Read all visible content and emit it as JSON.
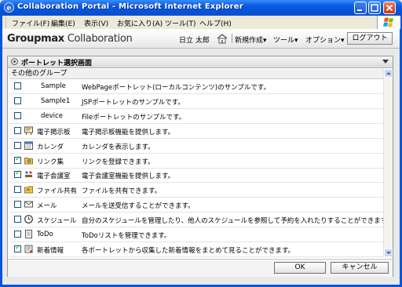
{
  "window": {
    "title": "Collaboration Portal - Microsoft Internet Explorer"
  },
  "menubar": [
    "ファイル(F)",
    "編集(E)",
    "表示(V)",
    "お気に入り(A)",
    "ツール(T)",
    "ヘルプ(H)"
  ],
  "header": {
    "brand_bold": "Groupmax",
    "brand_rest": " Collaboration",
    "user": "日立 太郎",
    "menus": [
      "新規作成▾",
      "ツール▾",
      "オプション▾"
    ],
    "logout": "ログアウト"
  },
  "dialog": {
    "title": "ポートレット選択画面",
    "group": "その他のグループ",
    "rows": [
      {
        "name": "Sample",
        "desc": "WebPageポートレット(ローカルコンテンツ)のサンプルです。",
        "checked": false,
        "icon": ""
      },
      {
        "name": "Sample1",
        "desc": "JSPポートレットのサンプルです。",
        "checked": false,
        "icon": ""
      },
      {
        "name": "device",
        "desc": "Fileポートレットのサンプルです。",
        "checked": false,
        "icon": ""
      },
      {
        "name": "電子掲示板",
        "desc": "電子掲示板機能を提供します。",
        "checked": false,
        "icon": "bulletin-board-icon"
      },
      {
        "name": "カレンダ",
        "desc": "カレンダを表示します。",
        "checked": false,
        "icon": "calendar-icon"
      },
      {
        "name": "リンク集",
        "desc": "リンクを登録できます。",
        "checked": true,
        "icon": "link-folder-icon"
      },
      {
        "name": "電子会議室",
        "desc": "電子会議室機能を提供します。",
        "checked": true,
        "icon": "meeting-room-icon"
      },
      {
        "name": "ファイル共有",
        "desc": "ファイルを共有できます。",
        "checked": false,
        "icon": "file-share-icon"
      },
      {
        "name": "メール",
        "desc": "メールを送受信することができます。",
        "checked": false,
        "icon": "mail-icon"
      },
      {
        "name": "スケジュール",
        "desc": "自分のスケジュールを管理したり、他人のスケジュールを参照して予約を入れたりすることができます。",
        "checked": false,
        "icon": "clock-icon"
      },
      {
        "name": "ToDo",
        "desc": "ToDoリストを管理できます。",
        "checked": false,
        "icon": "todo-icon"
      },
      {
        "name": "新着情報",
        "desc": "各ポートレットから収集した新着情報をまとめて見ることができます。",
        "checked": true,
        "icon": "news-icon"
      }
    ],
    "ok": "OK",
    "cancel": "キャンセル"
  }
}
